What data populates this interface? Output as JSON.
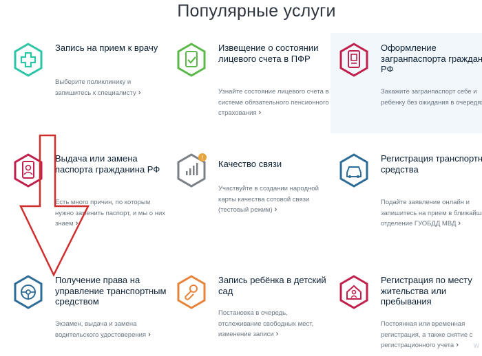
{
  "page": {
    "title": "Популярные услуги",
    "watermark": "W"
  },
  "colors": {
    "green": "#2cc6a6",
    "lime": "#5bb94a",
    "magenta": "#c1204d",
    "gold": "#7b7f86",
    "blue": "#2d6c96",
    "orange": "#e7843a",
    "red_arrow": "#d02d2d"
  },
  "services": [
    {
      "title": "Запись на прием к врачу",
      "description": "Выберите поликлинику и запишитесь к специалисту",
      "icon": "medical-cross-icon"
    },
    {
      "title": "Извещение о состоянии лицевого счета в ПФР",
      "description": "Узнайте состояние лицевого счета в системе обязательного пенсионного страхования",
      "icon": "document-check-icon"
    },
    {
      "title": "Оформление загранпаспорта гражданина РФ",
      "description": "Закажите загранпаспорт себе и ребенку без ожидания в очередях",
      "icon": "passport-icon"
    },
    {
      "title": "Выдача или замена паспорта гражданина РФ",
      "description": "Есть много причин, по которым нужно заменить паспорт, и мы о них знаем",
      "icon": "passport-photo-icon"
    },
    {
      "title": "Качество связи",
      "description": "Участвуйте в создании народной карты качества сотовой связи (тестовый режим)",
      "icon": "signal-icon",
      "badge": "!"
    },
    {
      "title": "Регистрация транспортного средства",
      "description": "Подайте заявление онлайн и запишитесь на прием в ближайшее отделение ГУОБДД МВД",
      "icon": "car-icon"
    },
    {
      "title": "Получение права на управление транспортным средством",
      "description": "Экзамен, выдача и замена водительского удостоверения",
      "icon": "steering-wheel-icon"
    },
    {
      "title": "Запись ребёнка в детский сад",
      "description": "Постановка в очередь, отслеживание свободных мест, изменение записи",
      "icon": "pacifier-icon"
    },
    {
      "title": "Регистрация по месту жительства или пребывания",
      "description": "Постоянная или временная регистрация, а также снятие с регистрационного учета",
      "icon": "house-person-icon"
    }
  ],
  "chevron": "›"
}
